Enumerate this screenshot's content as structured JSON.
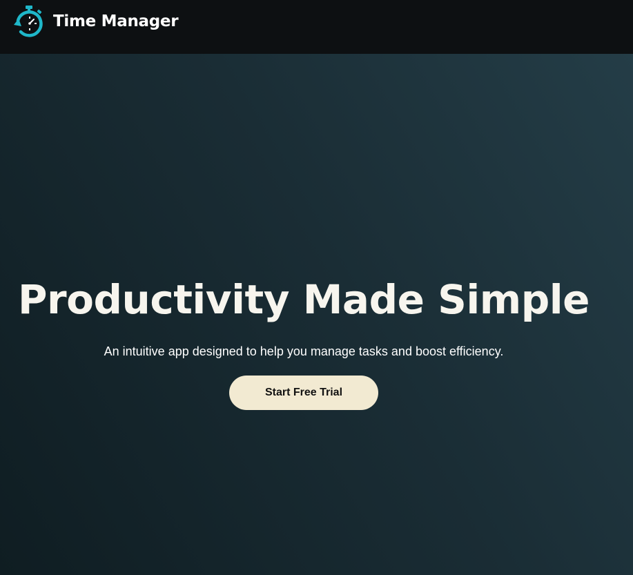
{
  "header": {
    "logo_icon": "stopwatch-icon",
    "brand_name": "Time Manager"
  },
  "hero": {
    "title": "Productivity Made Simple",
    "subtitle": "An intuitive app designed to help you manage tasks and boost efficiency.",
    "cta_label": "Start Free Trial"
  },
  "colors": {
    "topbar_bg": "#0d1012",
    "hero_bg_start": "#0f1d22",
    "hero_bg_end": "#243d47",
    "logo_accent": "#1fb7c9",
    "cta_bg": "#f2ead2",
    "cta_text": "#111111"
  }
}
